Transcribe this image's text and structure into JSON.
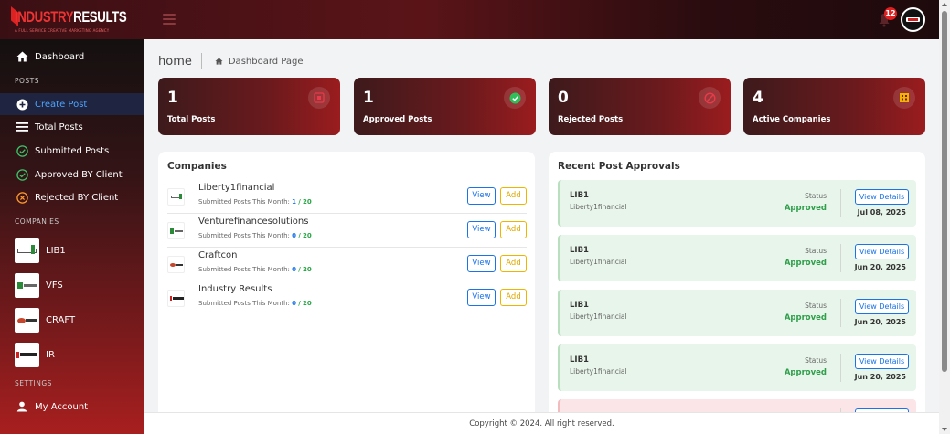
{
  "brand": {
    "logo_red": "INDUSTRY",
    "logo_white": "RESULTS",
    "tagline": "A FULL SERVICE CREATIVE MARKETING AGENCY"
  },
  "topbar": {
    "notification_count": "12"
  },
  "sidebar": {
    "dashboard_label": "Dashboard",
    "posts_section": "POSTS",
    "posts_items": [
      {
        "label": "Create Post",
        "icon": "plus-circle-icon"
      },
      {
        "label": "Total Posts",
        "icon": "list-icon"
      },
      {
        "label": "Submitted Posts",
        "icon": "check-circle-icon"
      },
      {
        "label": "Approved BY Client",
        "icon": "check-circle-filled-icon"
      },
      {
        "label": "Rejected BY Client",
        "icon": "x-circle-icon"
      }
    ],
    "companies_section": "COMPANIES",
    "companies": [
      {
        "label": "LIB1"
      },
      {
        "label": "VFS"
      },
      {
        "label": "CRAFT"
      },
      {
        "label": "IR"
      }
    ],
    "settings_section": "SETTINGS",
    "account_label": "My Account"
  },
  "breadcrumb": {
    "home": "home",
    "page": "Dashboard Page"
  },
  "stats": [
    {
      "value": "1",
      "label": "Total Posts",
      "icon": "post-icon",
      "icon_color": "#e83a4a"
    },
    {
      "value": "1",
      "label": "Approved Posts",
      "icon": "check-badge-icon",
      "icon_color": "#2fbf5a"
    },
    {
      "value": "0",
      "label": "Rejected Posts",
      "icon": "ban-icon",
      "icon_color": "#e83a4a"
    },
    {
      "value": "4",
      "label": "Active Companies",
      "icon": "building-icon",
      "icon_color": "#f2b400"
    }
  ],
  "companies_panel": {
    "title": "Companies",
    "sub_prefix": "Submitted Posts This Month:",
    "view_label": "View",
    "add_label": "Add",
    "rows": [
      {
        "name": "Liberty1financial",
        "used": "1",
        "sep": "/",
        "limit": "20"
      },
      {
        "name": "Venturefinancesolutions",
        "used": "0",
        "sep": "/",
        "limit": "20"
      },
      {
        "name": "Craftcon",
        "used": "0",
        "sep": "/",
        "limit": "20"
      },
      {
        "name": "Industry Results",
        "used": "0",
        "sep": "/",
        "limit": "20"
      }
    ]
  },
  "approvals_panel": {
    "title": "Recent Post Approvals",
    "status_label": "Status",
    "details_label": "View Details",
    "items": [
      {
        "code": "LIB1",
        "company": "Liberty1financial",
        "status": "Approved",
        "date": "Jul 08, 2025"
      },
      {
        "code": "LIB1",
        "company": "Liberty1financial",
        "status": "Approved",
        "date": "Jun 20, 2025"
      },
      {
        "code": "LIB1",
        "company": "Liberty1financial",
        "status": "Approved",
        "date": "Jun 20, 2025"
      },
      {
        "code": "LIB1",
        "company": "Liberty1financial",
        "status": "Approved",
        "date": "Jun 20, 2025"
      }
    ]
  },
  "footer": {
    "text": "Copyright © 2024. All right reserved."
  }
}
